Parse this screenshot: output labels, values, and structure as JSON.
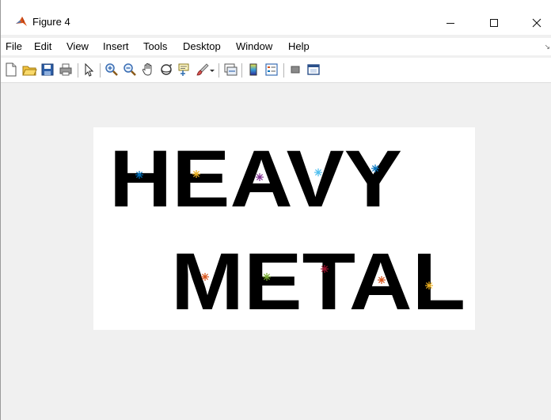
{
  "window": {
    "title": "Figure 4",
    "minimize_glyph": "—",
    "maximize_glyph": "☐",
    "close_glyph": "✕"
  },
  "menubar": {
    "items": [
      "File",
      "Edit",
      "View",
      "Insert",
      "Tools",
      "Desktop",
      "Window",
      "Help"
    ],
    "overflow_glyph": "↘"
  },
  "toolbar": {
    "buttons": [
      {
        "name": "new-figure-icon"
      },
      {
        "name": "open-file-icon"
      },
      {
        "name": "save-icon"
      },
      {
        "name": "print-icon"
      },
      {
        "name": "pointer-icon"
      },
      {
        "name": "zoom-in-icon"
      },
      {
        "name": "zoom-out-icon"
      },
      {
        "name": "pan-hand-icon"
      },
      {
        "name": "rotate-3d-icon"
      },
      {
        "name": "data-cursor-icon"
      },
      {
        "name": "brush-icon"
      },
      {
        "name": "brush-dropdown-icon"
      },
      {
        "name": "link-plot-icon"
      },
      {
        "name": "colorbar-icon"
      },
      {
        "name": "legend-icon"
      },
      {
        "name": "hide-plot-tools-icon"
      },
      {
        "name": "show-plot-tools-icon"
      }
    ]
  },
  "image": {
    "line1": "HEAVY",
    "line2": "METAL",
    "markers": [
      {
        "color": "#0072bd"
      },
      {
        "color": "#edb120"
      },
      {
        "color": "#7e2f8e"
      },
      {
        "color": "#4dbeee"
      },
      {
        "color": "#0072bd"
      },
      {
        "color": "#d95319"
      },
      {
        "color": "#77ac30"
      },
      {
        "color": "#a2142f"
      },
      {
        "color": "#d95319"
      },
      {
        "color": "#edb120"
      }
    ]
  }
}
